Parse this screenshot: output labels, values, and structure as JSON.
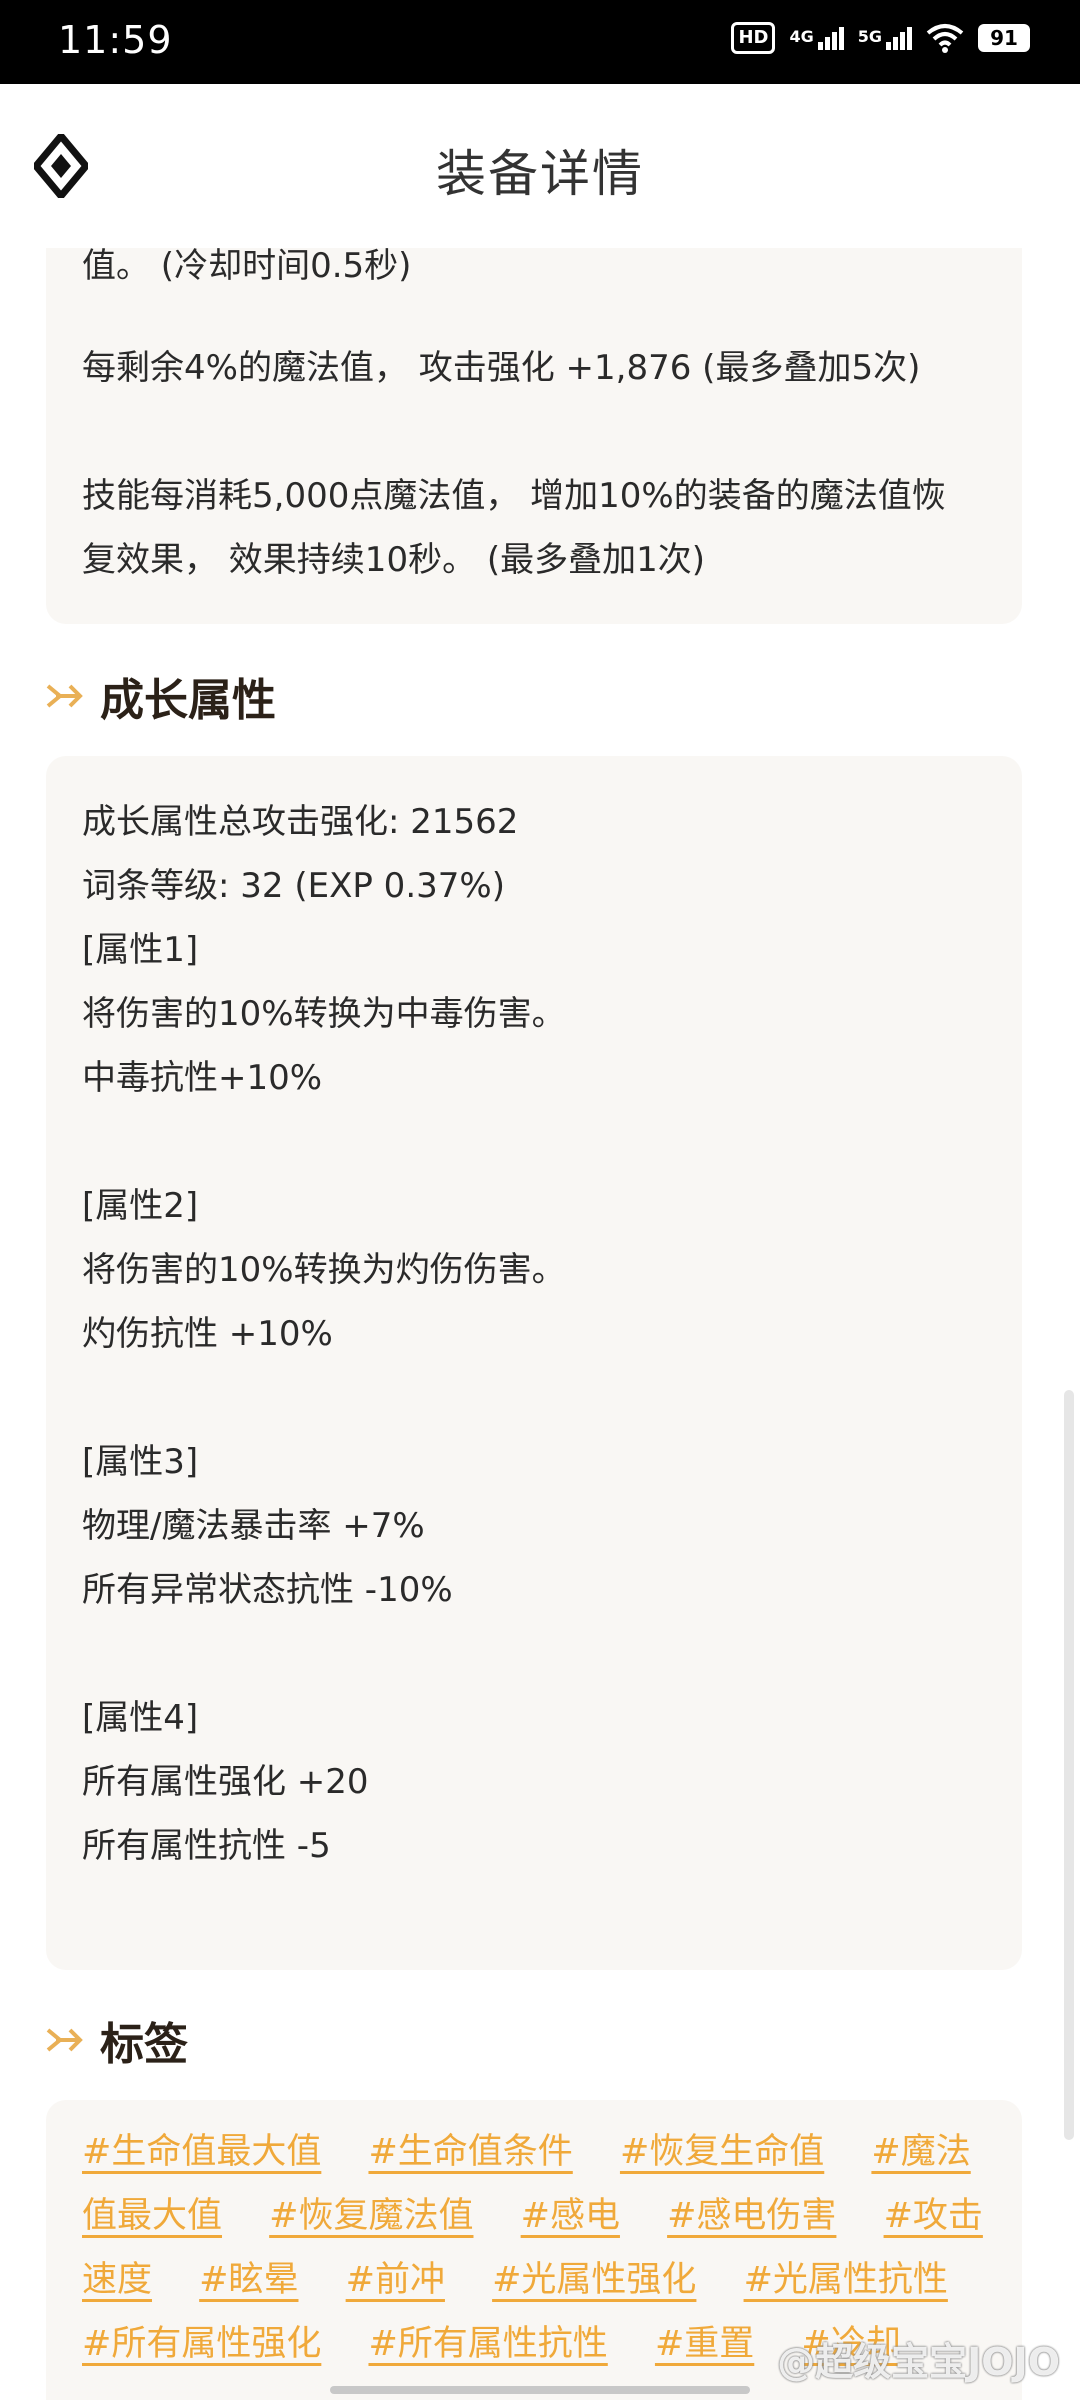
{
  "status": {
    "time": "11:59",
    "hd": "HD",
    "net1": "4G",
    "net2": "5G",
    "battery": "91"
  },
  "header": {
    "title": "装备详情"
  },
  "effects_card": {
    "line_cut": "值。 (冷却时间0.5秒)",
    "line1": "每剩余4%的魔法值， 攻击强化 +1,876 (最多叠加5次)",
    "line2a": "技能每消耗5,000点魔法值， 增加10%的装备的魔法值恢",
    "line2b": "复效果， 效果持续10秒。 (最多叠加1次)"
  },
  "growth": {
    "title": "成长属性",
    "lines": [
      "成长属性总攻击强化: 21562",
      "词条等级: 32 (EXP 0.37%)",
      "[属性1]",
      "将伤害的10%转换为中毒伤害。",
      "中毒抗性+10%",
      "",
      "[属性2]",
      "将伤害的10%转换为灼伤伤害。",
      "灼伤抗性 +10%",
      "",
      "[属性3]",
      "物理/魔法暴击率 +7%",
      "所有异常状态抗性 -10%",
      "",
      "[属性4]",
      "所有属性强化 +20",
      "所有属性抗性 -5"
    ]
  },
  "tags": {
    "title": "标签",
    "items": [
      "#生命值最大值",
      "#生命值条件",
      "#恢复生命值",
      "#魔法值最大值",
      "#恢复魔法值",
      "#感电",
      "#感电伤害",
      "#攻击速度",
      "#眩晕",
      "#前冲",
      "#光属性强化",
      "#光属性抗性",
      "#所有属性强化",
      "#所有属性抗性",
      "#重置",
      "#冷却"
    ]
  },
  "watermark": "@超级宝宝JOJO",
  "colors": {
    "accent": "#f0a93a",
    "card_bg": "#f9f7f4",
    "title": "#2b2118"
  }
}
